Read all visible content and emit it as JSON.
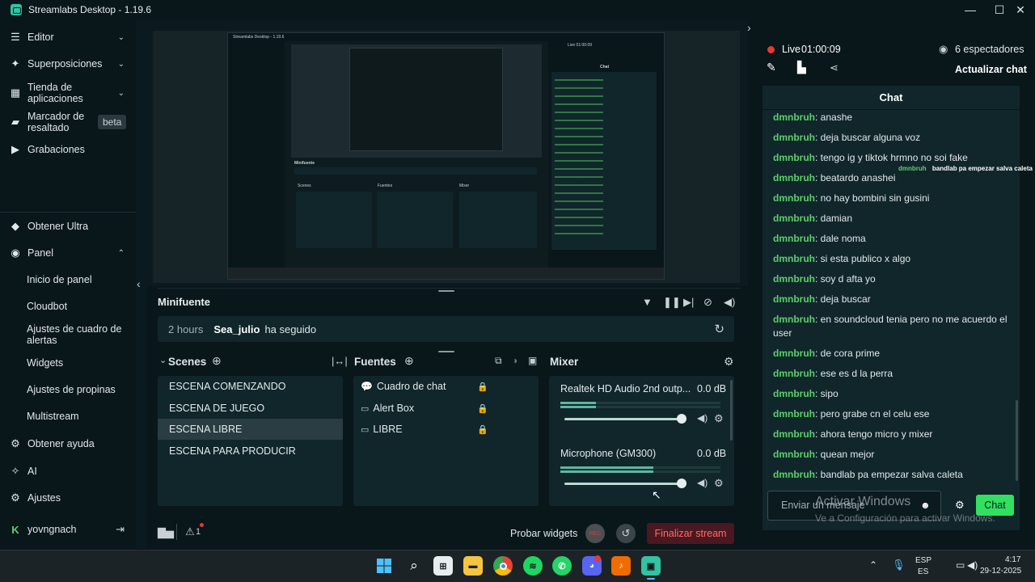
{
  "window": {
    "title": "Streamlabs Desktop - 1.19.6"
  },
  "sidebar": {
    "items": [
      {
        "label": "Editor",
        "icon": "editor-icon"
      },
      {
        "label": "Superposiciones",
        "icon": "themes-icon"
      },
      {
        "label": "Tienda de aplicaciones",
        "icon": "store-icon"
      },
      {
        "label": "Marcador de resaltado",
        "icon": "highlighter-icon",
        "badge": "beta"
      },
      {
        "label": "Grabaciones",
        "icon": "recordings-icon"
      },
      {
        "label": "Obtener Ultra",
        "icon": "ultra-icon"
      },
      {
        "label": "Panel",
        "icon": "dashboard-icon"
      },
      {
        "label": "Obtener ayuda",
        "icon": "help-icon"
      },
      {
        "label": "AI",
        "icon": "ai-icon"
      },
      {
        "label": "Ajustes",
        "icon": "settings-icon"
      }
    ],
    "panel_subitems": [
      "Inicio de panel",
      "Cloudbot",
      "Ajustes de cuadro de alertas",
      "Widgets",
      "Ajustes de propinas",
      "Multistream"
    ],
    "user": {
      "name": "yovngnach"
    }
  },
  "minifuente": {
    "title": "Minifuente",
    "event": {
      "time": "2 hours",
      "user": "Sea_julio",
      "action": "ha seguido"
    }
  },
  "scenes": {
    "title": "Scenes",
    "items": [
      "ESCENA COMENZANDO",
      "ESCENA DE JUEGO",
      "ESCENA LIBRE",
      "ESCENA PARA PRODUCIR"
    ],
    "selected_index": 2
  },
  "sources": {
    "title": "Fuentes",
    "items": [
      {
        "label": "Cuadro de chat",
        "icon": "chat-icon"
      },
      {
        "label": "Alert Box",
        "icon": "alert-icon"
      },
      {
        "label": "LIBRE",
        "icon": "monitor-icon"
      }
    ]
  },
  "mixer": {
    "title": "Mixer",
    "channels": [
      {
        "name": "Realtek HD Audio 2nd outp...",
        "db": "0.0 dB",
        "meter": 0.22,
        "volume": 1.0
      },
      {
        "name": "Microphone (GM300)",
        "db": "0.0 dB",
        "meter": 0.58,
        "volume": 1.0
      }
    ]
  },
  "bottombar": {
    "probar_widgets": "Probar widgets",
    "rec": "REC",
    "finalizar": "Finalizar stream",
    "alert_count": "1"
  },
  "live": {
    "label": "Live",
    "time": "01:00:09",
    "viewers": "6 espectadores",
    "refresh_chat": "Actualizar chat"
  },
  "chat": {
    "title": "Chat",
    "user": "dmnbruh",
    "messages": [
      "anashe",
      "deja buscar alguna voz",
      "tengo ig y tiktok hrmno no soi fake",
      "beatardo anashei",
      "no hay bombini sin gusini",
      "damian",
      "dale noma",
      "si esta publico x algo",
      "soy d afta yo",
      "deja buscar",
      "en soundcloud tenia pero no me acuerdo el user",
      "de cora prime",
      "ese es d la perra",
      "sipo",
      "pero grabe cn el celu ese",
      "ahora tengo micro y mixer",
      "quean mejor",
      "bandlab pa empezar salva caleta"
    ],
    "overlay_message": "bandlab pa empezar salva caleta",
    "input_placeholder": "Enviar un mensaje",
    "send_label": "Chat"
  },
  "watermark": {
    "title": "Activar Windows",
    "subtitle": "Ve a Configuración para activar Windows."
  },
  "taskbar": {
    "lang_top": "ESP",
    "lang_bottom": "ES",
    "time": "4:17",
    "date": "29-12-2025"
  },
  "preview_inner": {
    "title": "Streamlabs Desktop - 1.19.6",
    "minifuente": "Minifuente",
    "scenes": "Scenes",
    "fuentes": "Fuentes",
    "mixer": "Mixer",
    "live": "Live 01:00:09",
    "chat": "Chat"
  },
  "colors": {
    "accent": "#31c3a2",
    "live_red": "#e53935",
    "chat_user": "#5dd06a",
    "panel": "#10262b",
    "send_button": "#31e05f"
  }
}
